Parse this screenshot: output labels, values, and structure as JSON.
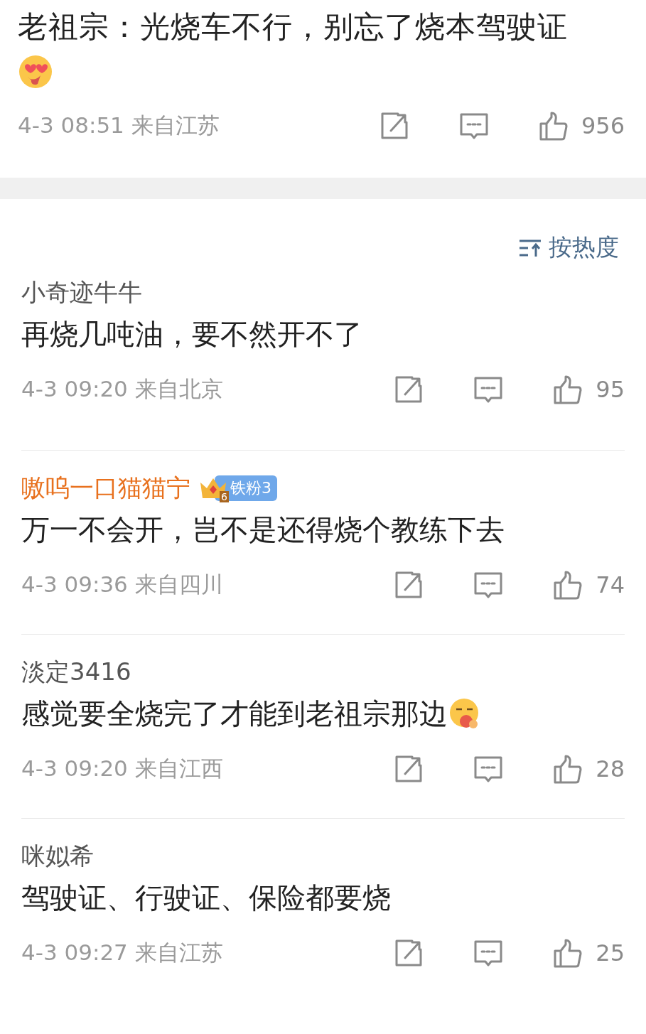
{
  "post": {
    "text": "老祖宗：光烧车不行，别忘了烧本驾驶证",
    "emoji": true,
    "time": "4-3 08:51",
    "location": "来自江苏",
    "likes": "956"
  },
  "sort": {
    "label": "按热度"
  },
  "comments": [
    {
      "author": "小奇迹牛牛",
      "member": false,
      "text": "再烧几吨油，要不然开不了",
      "emoji": false,
      "time": "4-3 09:20",
      "location": "来自北京",
      "likes": "95"
    },
    {
      "author": "嗷呜一口猫猫宁",
      "member": true,
      "badge": {
        "level": "6",
        "label": "铁粉3"
      },
      "text": "万一不会开，岂不是还得烧个教练下去",
      "emoji": false,
      "time": "4-3 09:36",
      "location": "来自四川",
      "likes": "74"
    },
    {
      "author": "淡定3416",
      "member": false,
      "text": "感觉要全烧完了才能到老祖宗那边",
      "emoji": true,
      "time": "4-3 09:20",
      "location": "来自江西",
      "likes": "28"
    },
    {
      "author": "咪姒希",
      "member": false,
      "text": "驾驶证、行驶证、保险都要烧",
      "emoji": false,
      "time": "4-3 09:27",
      "location": "来自江苏",
      "likes": "25"
    }
  ]
}
